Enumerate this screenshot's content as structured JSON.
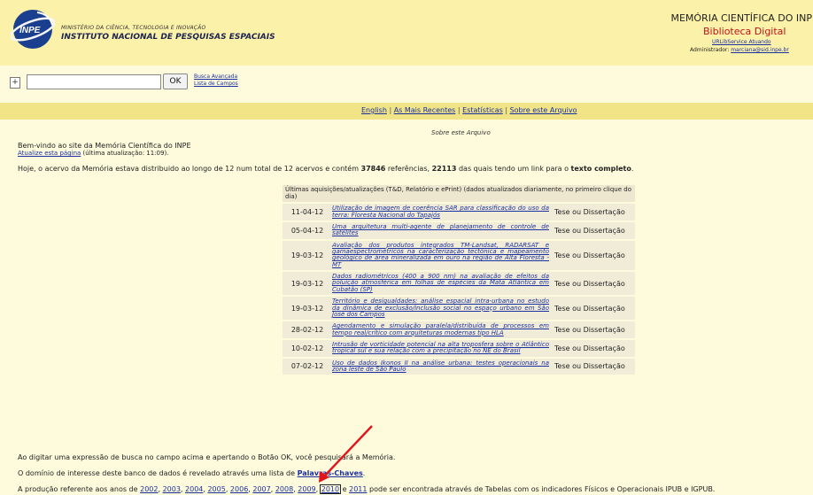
{
  "header": {
    "logo_text": "INPE",
    "ministry": "MINISTÉRIO DA CIÊNCIA, TECNOLOGIA E INOVAÇÃO",
    "institute": "INSTITUTO NACIONAL DE PESQUISAS ESPACIAIS",
    "memoria": "MEMÓRIA CIENTÍFICA DO INPE",
    "biblioteca": "Biblioteca Digital",
    "urlib": "URLibService Atuando",
    "admin_label": "Administrador: ",
    "admin_email": "marciana@sid.inpe.br"
  },
  "search": {
    "plus": "+",
    "value": "",
    "ok": "OK",
    "advanced": "Busca Avançada",
    "fields": "Lista de Campos"
  },
  "nav": {
    "english": "English",
    "recent": "As Mais Recentes",
    "stats": "Estatísticas",
    "about": "Sobre este Arquivo",
    "sep": "|"
  },
  "about_title": "Sobre este Arquivo",
  "welcome": "Bem-vindo ao site da Memória Científica do INPE",
  "update": {
    "link": "Atualize esta página",
    "rest": " (última atualização: 11:09)."
  },
  "stats": {
    "part1": "Hoje, o acervo da Memória estava distribuido ao longo de 12 num total de 12 acervos e contém ",
    "refs": "37846",
    "part2": " referências, ",
    "linked": "22113",
    "part3": " das quais tendo um link para o ",
    "full": "texto completo",
    "part4": "."
  },
  "table": {
    "caption": "Últimas aquisições/atualizações (T&D, Relatório e ePrint) (dados atualizados diariamente, no primeiro clique do dia)",
    "rows": [
      {
        "date": "11-04-12",
        "title": "Utilização de imagem de coerência SAR para classificação do uso da terra: Floresta Nacional do Tapajós",
        "type": "Tese ou Dissertação"
      },
      {
        "date": "05-04-12",
        "title": "Uma arquitetura multi-agente de planejamento de controle de satélites",
        "type": "Tese ou Dissertação"
      },
      {
        "date": "19-03-12",
        "title": "Avaliação dos produtos integrados TM-Landsat, RADARSAT e gamaespectrométricos na caracterização tectônica e mapeamento geológico de área mineralizada em ouro na região de Alta Floresta - MT",
        "type": "Tese ou Dissertação"
      },
      {
        "date": "19-03-12",
        "title": "Dados radiométricos (400 a 900 nm) na avaliação de efeitos da poluição atmosférica em folhas de espécies da Mata Atlântica em Cubatão (SP)",
        "type": "Tese ou Dissertação"
      },
      {
        "date": "19-03-12",
        "title": "Território e desigualdades: análise espacial intra-urbana no estudo da dinâmica de exclusão/inclusão social no espaço urbano em São José dos Campos",
        "type": "Tese ou Dissertação"
      },
      {
        "date": "28-02-12",
        "title": "Agendamento e simulação paralela/distribuída de processos em tempo real/crítico com arquiteturas modernas tipo HLA",
        "type": "Tese ou Dissertação"
      },
      {
        "date": "10-02-12",
        "title": "Intrusão de vorticidade potencial na alta troposfera sobre o Atlântico tropical sul e sua relação com a precipitação no NE do Brasil",
        "type": "Tese ou Dissertação"
      },
      {
        "date": "07-02-12",
        "title": "Uso de dados Ikonos II na análise urbana: testes operacionais na zona leste de São Paulo",
        "type": "Tese ou Dissertação"
      }
    ]
  },
  "footer": {
    "typing": "Ao digitar uma expressão de busca no campo acima e apertando o Botão OK, você pesquisará a Memória.",
    "domain_pre": "O domínio de interesse deste banco de dados é revelado através uma lista de ",
    "domain_link": "Palavras-Chaves",
    "domain_post": ".",
    "prod_pre": "A produção referente aos anos de ",
    "years": [
      "2002",
      "2003",
      "2004",
      "2005",
      "2006",
      "2007",
      "2008",
      "2009",
      "2010"
    ],
    "conj": " e ",
    "last_year": "2011",
    "prod_post": " pode ser encontrada através de Tabelas com os indicadores Físicos e Operacionais IPUB e IGPUB.",
    "comma": ", "
  },
  "colors": {
    "header_bg": "#fcf1a8",
    "page_bg": "#fdfbdc",
    "nav_bg": "#f1e486",
    "link": "#1a2fa0",
    "biblioteca": "#c0111a",
    "arrow": "#e0141a"
  }
}
